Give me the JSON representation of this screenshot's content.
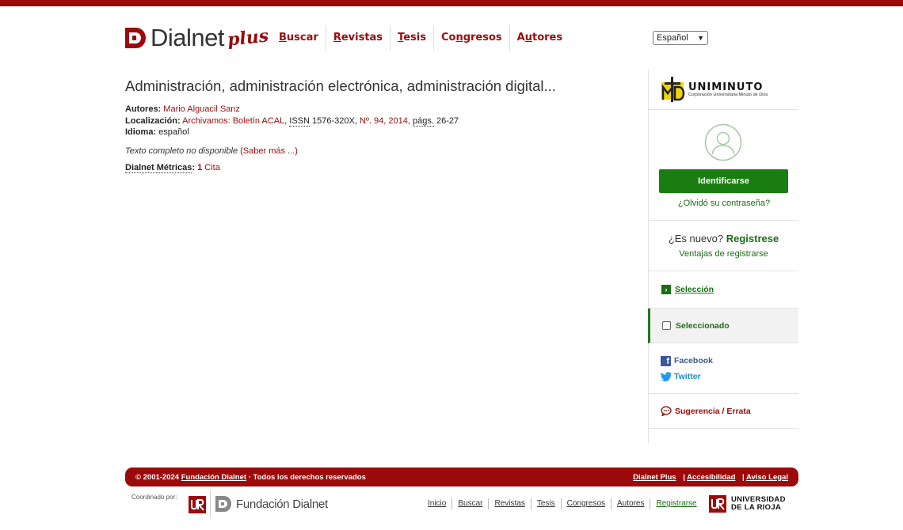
{
  "brand": {
    "name": "Dialnet",
    "suffix": "plus"
  },
  "nav": [
    {
      "label": "Buscar",
      "accel": "B",
      "rest": "uscar"
    },
    {
      "label": "Revistas",
      "accel": "R",
      "rest": "evistas"
    },
    {
      "label": "Tesis",
      "accel": "T",
      "rest": "esis"
    },
    {
      "label": "Congresos",
      "pre": "Co",
      "accel": "n",
      "rest": "gresos"
    },
    {
      "label": "Autores",
      "pre": "A",
      "accel": "u",
      "rest": "tores"
    }
  ],
  "language": {
    "selected": "Español"
  },
  "document": {
    "title": "Administración, administración electrónica, administración digital...",
    "authors_label": "Autores:",
    "authors_value": "Mario Alguacil Sanz",
    "location_label": "Localización:",
    "location_journal": "Archivamos: Boletín ACAL",
    "issn_label": "ISSN",
    "issn_value": "1576-320X,",
    "issue": "Nº. 94, 2014",
    "pages_label": "págs.",
    "pages_value": "26-27",
    "language_label": "Idioma:",
    "language_value": "español",
    "fulltext_note": "Texto completo no disponible",
    "fulltext_link": "(Saber más ...)",
    "metrics_label": "Dialnet Métricas",
    "metrics_count": "1",
    "metrics_unit": "Cita"
  },
  "sidebar": {
    "institution": {
      "name": "UNIMINUTO",
      "subtitle": "Corporación Universitaria Minuto de Dios"
    },
    "login_button": "Identificarse",
    "forgot_password": "¿Olvidó su contraseña?",
    "new_question": "¿Es nuevo?",
    "register": "Registrese",
    "register_benefits": "Ventajas de registrarse",
    "selection": "Selección",
    "selected": "Seleccionado",
    "facebook": "Facebook",
    "twitter": "Twitter",
    "suggestion": "Sugerencia / Errata"
  },
  "footer": {
    "copyright_pre": "© 2001-2024",
    "foundation_link": "Fundación Dialnet",
    "copyright_post": "· Todos los derechos reservados",
    "links": [
      "Dialnet Plus",
      "Accesibilidad",
      "Aviso Legal"
    ],
    "coordinated_by": "Coordinado por:",
    "foundation_logo": "Fundación Dialnet",
    "nav": [
      "Inicio",
      "Buscar",
      "Revistas",
      "Tesis",
      "Congresos",
      "Autores",
      "Registrarse"
    ],
    "university_line1": "UNIVERSIDAD",
    "university_line2": "DE LA RIOJA"
  },
  "colors": {
    "brand_red": "#9b0b0b",
    "green": "#1a7d12"
  }
}
